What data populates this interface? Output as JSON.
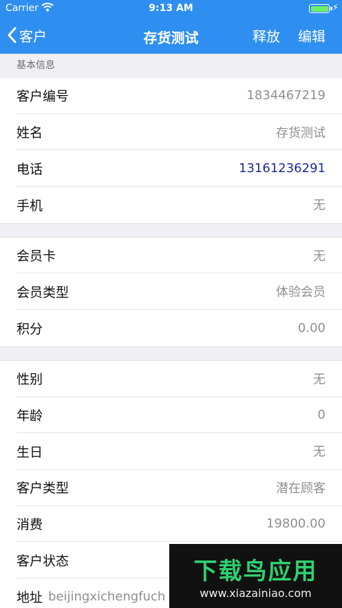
{
  "status_bar": {
    "carrier": "Carrier",
    "time": "9:13 AM"
  },
  "navbar": {
    "back_label": "客户",
    "title": "存货测试",
    "release_label": "释放",
    "edit_label": "编辑"
  },
  "sections": {
    "basic_info_header": "基本信息"
  },
  "basic": {
    "customer_no_label": "客户编号",
    "customer_no_value": "1834467219",
    "name_label": "姓名",
    "name_value": "存货测试",
    "phone_label": "电话",
    "phone_value": "13161236291",
    "mobile_label": "手机",
    "mobile_value": "无"
  },
  "member": {
    "card_label": "会员卡",
    "card_value": "无",
    "type_label": "会员类型",
    "type_value": "体验会员",
    "points_label": "积分",
    "points_value": "0.00"
  },
  "detail": {
    "gender_label": "性别",
    "gender_value": "无",
    "age_label": "年龄",
    "age_value": "0",
    "birthday_label": "生日",
    "birthday_value": "无",
    "customer_type_label": "客户类型",
    "customer_type_value": "潜在顾客",
    "spend_label": "消费",
    "spend_value": "19800.00",
    "status_label": "客户状态",
    "address_label": "地址",
    "address_value": "beijingxichengfuch"
  },
  "watermark": {
    "main": "下载鸟应用",
    "sub": "www.xiazainiao.com"
  },
  "colors": {
    "nav_bg": "#2f8ff0",
    "phone_link": "#1a2c9c",
    "watermark_green": "#2fd070"
  }
}
